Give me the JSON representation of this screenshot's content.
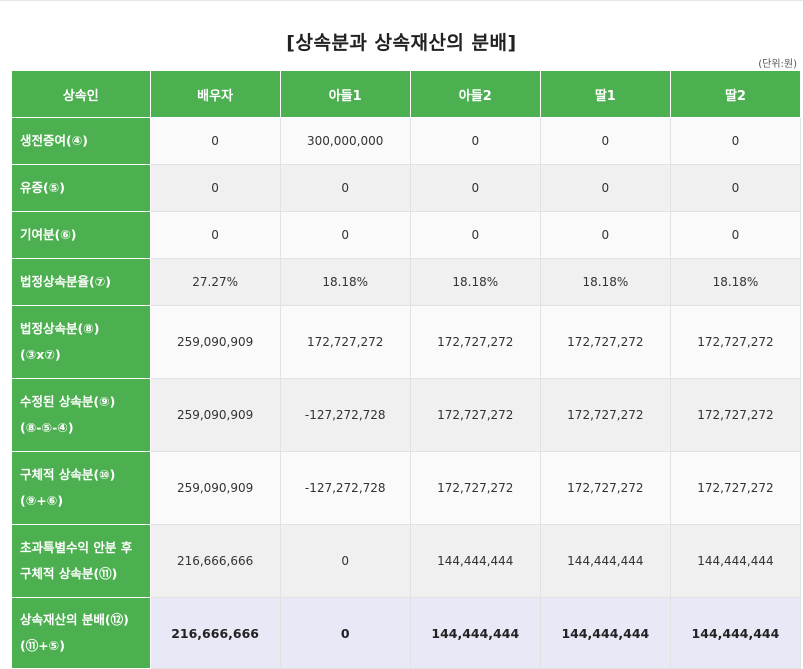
{
  "title": "[상속분과 상속재산의 분배]",
  "unit": "(단위:원)",
  "columns": [
    "상속인",
    "배우자",
    "아들1",
    "아들2",
    "딸1",
    "딸2"
  ],
  "rows": [
    {
      "label_lines": [
        "생전증여(④)"
      ],
      "values": [
        "0",
        "300,000,000",
        "0",
        "0",
        "0"
      ]
    },
    {
      "label_lines": [
        "유증(⑤)"
      ],
      "values": [
        "0",
        "0",
        "0",
        "0",
        "0"
      ]
    },
    {
      "label_lines": [
        "기여분(⑥)"
      ],
      "values": [
        "0",
        "0",
        "0",
        "0",
        "0"
      ]
    },
    {
      "label_lines": [
        "법정상속분율(⑦)"
      ],
      "values": [
        "27.27%",
        "18.18%",
        "18.18%",
        "18.18%",
        "18.18%"
      ]
    },
    {
      "label_lines": [
        "법정상속분(⑧)",
        "(③x⑦)"
      ],
      "values": [
        "259,090,909",
        "172,727,272",
        "172,727,272",
        "172,727,272",
        "172,727,272"
      ]
    },
    {
      "label_lines": [
        "수정된 상속분(⑨)",
        "(⑧-⑤-④)"
      ],
      "values": [
        "259,090,909",
        "-127,272,728",
        "172,727,272",
        "172,727,272",
        "172,727,272"
      ]
    },
    {
      "label_lines": [
        "구체적 상속분(⑩)",
        "(⑨+⑥)"
      ],
      "values": [
        "259,090,909",
        "-127,272,728",
        "172,727,272",
        "172,727,272",
        "172,727,272"
      ]
    },
    {
      "label_lines": [
        "초과특별수익 안분 후",
        "구체적 상속분(⑪)"
      ],
      "values": [
        "216,666,666",
        "0",
        "144,444,444",
        "144,444,444",
        "144,444,444"
      ]
    },
    {
      "label_lines": [
        "상속재산의 분배(⑫)",
        "(⑪+⑤)"
      ],
      "values": [
        "216,666,666",
        "0",
        "144,444,444",
        "144,444,444",
        "144,444,444"
      ]
    }
  ],
  "colors": {
    "header_green": "#4caf50",
    "final_row_bg": "#e8e8f7"
  }
}
